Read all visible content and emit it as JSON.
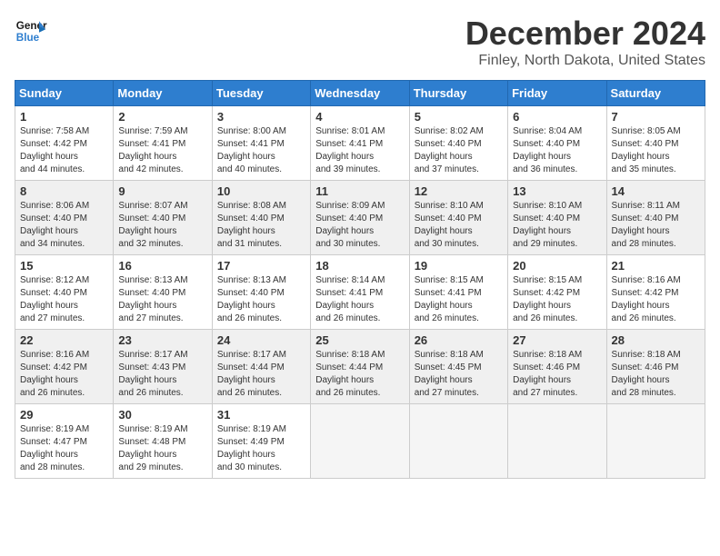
{
  "logo": {
    "line1": "General",
    "line2": "Blue"
  },
  "title": "December 2024",
  "subtitle": "Finley, North Dakota, United States",
  "weekdays": [
    "Sunday",
    "Monday",
    "Tuesday",
    "Wednesday",
    "Thursday",
    "Friday",
    "Saturday"
  ],
  "weeks": [
    [
      {
        "day": "1",
        "sunrise": "7:58 AM",
        "sunset": "4:42 PM",
        "daylight": "8 hours and 44 minutes."
      },
      {
        "day": "2",
        "sunrise": "7:59 AM",
        "sunset": "4:41 PM",
        "daylight": "8 hours and 42 minutes."
      },
      {
        "day": "3",
        "sunrise": "8:00 AM",
        "sunset": "4:41 PM",
        "daylight": "8 hours and 40 minutes."
      },
      {
        "day": "4",
        "sunrise": "8:01 AM",
        "sunset": "4:41 PM",
        "daylight": "8 hours and 39 minutes."
      },
      {
        "day": "5",
        "sunrise": "8:02 AM",
        "sunset": "4:40 PM",
        "daylight": "8 hours and 37 minutes."
      },
      {
        "day": "6",
        "sunrise": "8:04 AM",
        "sunset": "4:40 PM",
        "daylight": "8 hours and 36 minutes."
      },
      {
        "day": "7",
        "sunrise": "8:05 AM",
        "sunset": "4:40 PM",
        "daylight": "8 hours and 35 minutes."
      }
    ],
    [
      {
        "day": "8",
        "sunrise": "8:06 AM",
        "sunset": "4:40 PM",
        "daylight": "8 hours and 34 minutes."
      },
      {
        "day": "9",
        "sunrise": "8:07 AM",
        "sunset": "4:40 PM",
        "daylight": "8 hours and 32 minutes."
      },
      {
        "day": "10",
        "sunrise": "8:08 AM",
        "sunset": "4:40 PM",
        "daylight": "8 hours and 31 minutes."
      },
      {
        "day": "11",
        "sunrise": "8:09 AM",
        "sunset": "4:40 PM",
        "daylight": "8 hours and 30 minutes."
      },
      {
        "day": "12",
        "sunrise": "8:10 AM",
        "sunset": "4:40 PM",
        "daylight": "8 hours and 30 minutes."
      },
      {
        "day": "13",
        "sunrise": "8:10 AM",
        "sunset": "4:40 PM",
        "daylight": "8 hours and 29 minutes."
      },
      {
        "day": "14",
        "sunrise": "8:11 AM",
        "sunset": "4:40 PM",
        "daylight": "8 hours and 28 minutes."
      }
    ],
    [
      {
        "day": "15",
        "sunrise": "8:12 AM",
        "sunset": "4:40 PM",
        "daylight": "8 hours and 27 minutes."
      },
      {
        "day": "16",
        "sunrise": "8:13 AM",
        "sunset": "4:40 PM",
        "daylight": "8 hours and 27 minutes."
      },
      {
        "day": "17",
        "sunrise": "8:13 AM",
        "sunset": "4:40 PM",
        "daylight": "8 hours and 26 minutes."
      },
      {
        "day": "18",
        "sunrise": "8:14 AM",
        "sunset": "4:41 PM",
        "daylight": "8 hours and 26 minutes."
      },
      {
        "day": "19",
        "sunrise": "8:15 AM",
        "sunset": "4:41 PM",
        "daylight": "8 hours and 26 minutes."
      },
      {
        "day": "20",
        "sunrise": "8:15 AM",
        "sunset": "4:42 PM",
        "daylight": "8 hours and 26 minutes."
      },
      {
        "day": "21",
        "sunrise": "8:16 AM",
        "sunset": "4:42 PM",
        "daylight": "8 hours and 26 minutes."
      }
    ],
    [
      {
        "day": "22",
        "sunrise": "8:16 AM",
        "sunset": "4:42 PM",
        "daylight": "8 hours and 26 minutes."
      },
      {
        "day": "23",
        "sunrise": "8:17 AM",
        "sunset": "4:43 PM",
        "daylight": "8 hours and 26 minutes."
      },
      {
        "day": "24",
        "sunrise": "8:17 AM",
        "sunset": "4:44 PM",
        "daylight": "8 hours and 26 minutes."
      },
      {
        "day": "25",
        "sunrise": "8:18 AM",
        "sunset": "4:44 PM",
        "daylight": "8 hours and 26 minutes."
      },
      {
        "day": "26",
        "sunrise": "8:18 AM",
        "sunset": "4:45 PM",
        "daylight": "8 hours and 27 minutes."
      },
      {
        "day": "27",
        "sunrise": "8:18 AM",
        "sunset": "4:46 PM",
        "daylight": "8 hours and 27 minutes."
      },
      {
        "day": "28",
        "sunrise": "8:18 AM",
        "sunset": "4:46 PM",
        "daylight": "8 hours and 28 minutes."
      }
    ],
    [
      {
        "day": "29",
        "sunrise": "8:19 AM",
        "sunset": "4:47 PM",
        "daylight": "8 hours and 28 minutes."
      },
      {
        "day": "30",
        "sunrise": "8:19 AM",
        "sunset": "4:48 PM",
        "daylight": "8 hours and 29 minutes."
      },
      {
        "day": "31",
        "sunrise": "8:19 AM",
        "sunset": "4:49 PM",
        "daylight": "8 hours and 30 minutes."
      },
      null,
      null,
      null,
      null
    ]
  ],
  "labels": {
    "sunrise": "Sunrise:",
    "sunset": "Sunset:",
    "daylight": "Daylight hours"
  }
}
